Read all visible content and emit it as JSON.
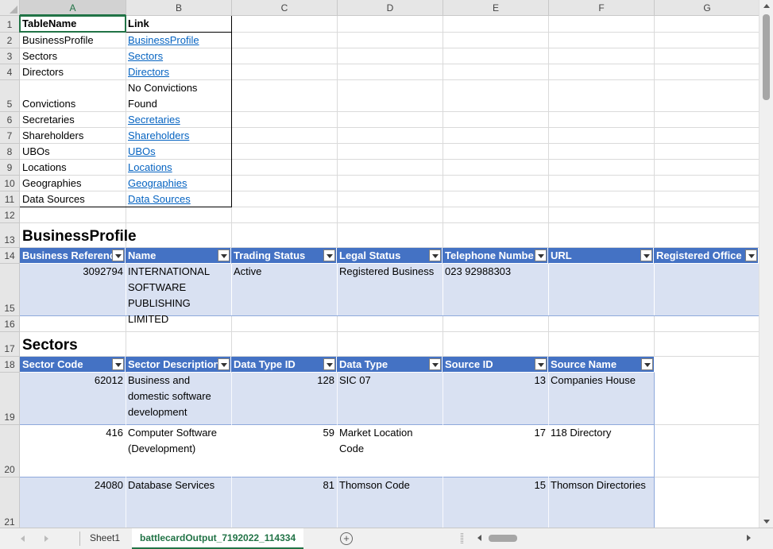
{
  "columns": [
    "A",
    "B",
    "C",
    "D",
    "E",
    "F",
    "G"
  ],
  "rows": [
    "1",
    "2",
    "3",
    "4",
    "5",
    "6",
    "7",
    "8",
    "9",
    "10",
    "11",
    "12",
    "13",
    "14",
    "15",
    "16",
    "17",
    "18",
    "19",
    "20",
    "21"
  ],
  "index_table": {
    "headers": [
      "TableName",
      "Link"
    ],
    "rows": [
      {
        "name": "BusinessProfile",
        "link": "BusinessProfile"
      },
      {
        "name": "Sectors",
        "link": "Sectors"
      },
      {
        "name": "Directors",
        "link": "Directors"
      },
      {
        "name": "Convictions",
        "link": "No Convictions Found"
      },
      {
        "name": "Secretaries",
        "link": "Secretaries"
      },
      {
        "name": "Shareholders",
        "link": "Shareholders"
      },
      {
        "name": "UBOs",
        "link": "UBOs"
      },
      {
        "name": "Locations",
        "link": "Locations"
      },
      {
        "name": "Geographies",
        "link": "Geographies"
      },
      {
        "name": "Data Sources",
        "link": "Data Sources"
      }
    ]
  },
  "business_profile": {
    "title": "BusinessProfile",
    "headers": [
      "Business Referenc",
      "Name",
      "Trading Status",
      "Legal Status",
      "Telephone Numbe",
      "URL",
      "Registered Office"
    ],
    "row": [
      "3092794",
      "INTERNATIONAL SOFTWARE PUBLISHING LIMITED",
      "Active",
      "Registered Business",
      "023 92988303",
      "",
      ""
    ]
  },
  "sectors": {
    "title": "Sectors",
    "headers": [
      "Sector Code",
      "Sector Description",
      "Data Type ID",
      "Data Type",
      "Source ID",
      "Source Name"
    ],
    "rows": [
      [
        "62012",
        "Business and domestic software development",
        "128",
        "SIC 07",
        "13",
        "Companies House"
      ],
      [
        "416",
        "Computer Software (Development)",
        "59",
        "Market Location Code",
        "17",
        "118 Directory"
      ],
      [
        "24080",
        "Database Services",
        "81",
        "Thomson Code",
        "15",
        "Thomson Directories"
      ]
    ]
  },
  "tabs": {
    "sheet1": "Sheet1",
    "active": "battlecardOutput_7192022_114334",
    "add": "+"
  },
  "colors": {
    "header_blue": "#4472c4",
    "band": "#d9e1f2",
    "link": "#0563c1",
    "excel_green": "#217346"
  }
}
